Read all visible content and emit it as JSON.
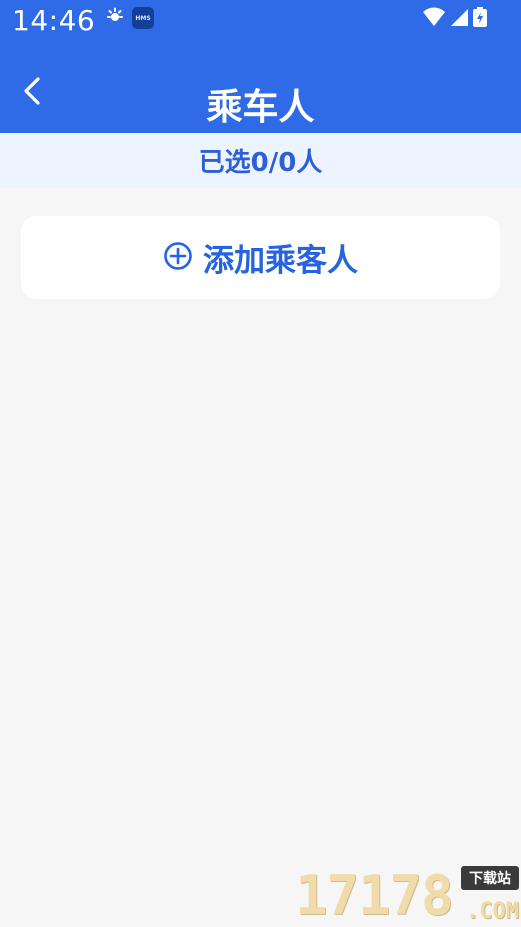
{
  "status_bar": {
    "time": "14:46",
    "icons": [
      "sun-notification-icon",
      "hms-icon",
      "wifi-icon",
      "cellular-signal-icon",
      "battery-charging-icon"
    ],
    "hms_label": "HMS"
  },
  "header": {
    "title": "乘车人",
    "back_icon": "chevron-left-icon",
    "background_color": "#2f6be6"
  },
  "selection": {
    "text": "已选0/0人"
  },
  "actions": {
    "add_passenger_label": "添加乘客人",
    "add_icon": "add-circle-icon",
    "accent_color": "#2563e0"
  },
  "watermark": {
    "number": "17178",
    "site": "下载站",
    "domain": ".COM"
  }
}
